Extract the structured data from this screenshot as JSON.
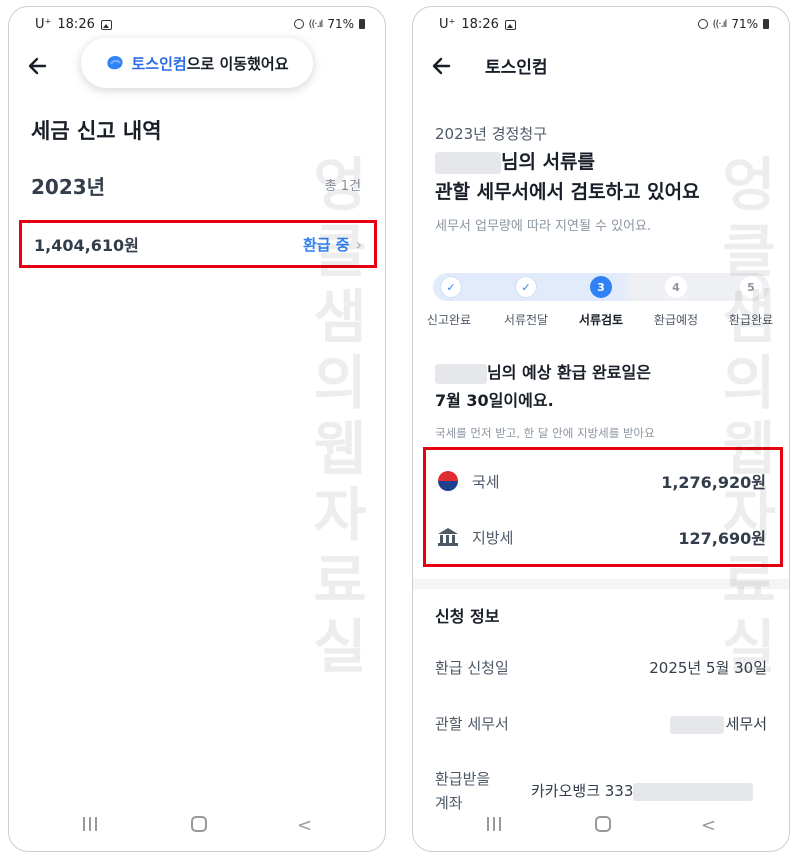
{
  "status_bar": {
    "carrier": "U⁺",
    "time": "18:26",
    "battery": "71%"
  },
  "left": {
    "toast": {
      "brand": "토스인컴",
      "message": "으로 이동했어요"
    },
    "title": "세금 신고 내역",
    "year": "2023년",
    "count": "총 1건",
    "item": {
      "amount": "1,404,610원",
      "status": "환급 중"
    }
  },
  "right": {
    "header_title": "토스인컴",
    "subtitle": "2023년 경정청구",
    "headline_line1_suffix": "님의 서류를",
    "headline_line2": "관할 세무서에서 검토하고 있어요",
    "description": "세무서 업무량에 따라 지연될 수 있어요.",
    "steps": [
      {
        "num": "1",
        "label": "신고완료",
        "state": "done"
      },
      {
        "num": "2",
        "label": "서류전달",
        "state": "done"
      },
      {
        "num": "3",
        "label": "서류검토",
        "state": "current"
      },
      {
        "num": "4",
        "label": "환급예정",
        "state": "todo"
      },
      {
        "num": "5",
        "label": "환급완료",
        "state": "todo"
      }
    ],
    "refund_line1_suffix": "님의 예상 환급 완료일은",
    "refund_line2": "7월 30일이에요.",
    "refund_desc": "국세를 먼저 받고, 한 달 안에 지방세를 받아요",
    "national_tax": {
      "label": "국세",
      "value": "1,276,920원"
    },
    "local_tax": {
      "label": "지방세",
      "value": "127,690원"
    },
    "info_title": "신청 정보",
    "apply_date": {
      "label": "환급 신청일",
      "value": "2025년 5월 30일"
    },
    "tax_office": {
      "label": "관할 세무서",
      "value": "세무서"
    },
    "account": {
      "label_line1": "환급받을",
      "label_line2": "계좌",
      "value": "카카오뱅크 333"
    }
  },
  "watermark": [
    "엉",
    "클",
    "샘",
    "의",
    "웹",
    "자",
    "료",
    "실"
  ]
}
